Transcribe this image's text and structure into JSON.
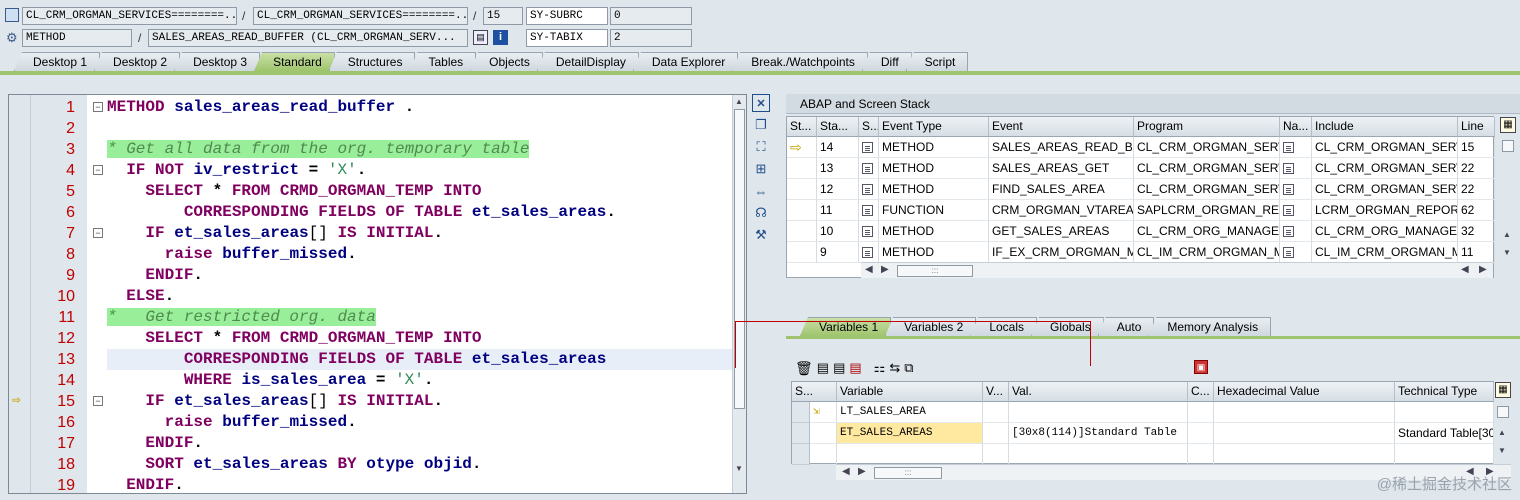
{
  "header": {
    "row1": {
      "class_field_1": "CL_CRM_ORGMAN_SERVICES========...",
      "class_field_2": "CL_CRM_ORGMAN_SERVICES========...",
      "line_field": "15",
      "sysvar_name": "SY-SUBRC",
      "sysvar_value": "0"
    },
    "row2": {
      "kind_field": "METHOD",
      "event_field": "SALES_AREAS_READ_BUFFER (CL_CRM_ORGMAN_SERV...",
      "sysvar_name": "SY-TABIX",
      "sysvar_value": "2"
    },
    "separator": "/"
  },
  "desktop_tabs": [
    {
      "label": "Desktop 1",
      "active": false
    },
    {
      "label": "Desktop 2",
      "active": false
    },
    {
      "label": "Desktop 3",
      "active": false
    },
    {
      "label": "Standard",
      "active": true
    },
    {
      "label": "Structures",
      "active": false
    },
    {
      "label": "Tables",
      "active": false
    },
    {
      "label": "Objects",
      "active": false
    },
    {
      "label": "DetailDisplay",
      "active": false
    },
    {
      "label": "Data Explorer",
      "active": false
    },
    {
      "label": "Break./Watchpoints",
      "active": false
    },
    {
      "label": "Diff",
      "active": false
    },
    {
      "label": "Script",
      "active": false
    }
  ],
  "code": [
    {
      "n": "1",
      "fold": "−",
      "html": "<span class=\"kw\">METHOD</span> <span class=\"id\">sales_areas_read_buffer</span> ."
    },
    {
      "n": "2",
      "fold": "",
      "html": ""
    },
    {
      "n": "3",
      "fold": "",
      "html": "<span class=\"cmt\">* Get all data from the org. temporary table</span>"
    },
    {
      "n": "4",
      "fold": "−",
      "html": "  <span class=\"kw\">IF</span> <span class=\"kw\">NOT</span> <span class=\"id\">iv_restrict</span> = <span class=\"str\">'X'</span>."
    },
    {
      "n": "5",
      "fold": "",
      "html": "    <span class=\"kw\">SELECT</span> * <span class=\"kw\">FROM</span> <span class=\"kw\">CRMD_ORGMAN_TEMP</span> <span class=\"kw\">INTO</span>"
    },
    {
      "n": "6",
      "fold": "",
      "html": "        <span class=\"kw\">CORRESPONDING</span> <span class=\"kw\">FIELDS</span> <span class=\"kw\">OF</span> <span class=\"kw\">TABLE</span> <span class=\"id\">et_sales_areas</span>."
    },
    {
      "n": "7",
      "fold": "−",
      "html": "    <span class=\"kw\">IF</span> <span class=\"id\">et_sales_areas</span><span style=\"font-weight:normal\">[]</span> <span class=\"kw\">IS</span> <span class=\"kw\">INITIAL</span>."
    },
    {
      "n": "8",
      "fold": "",
      "html": "      <span class=\"kw\">raise</span> <span class=\"id\">buffer_missed</span>."
    },
    {
      "n": "9",
      "fold": "",
      "html": "    <span class=\"kw\">ENDIF</span>."
    },
    {
      "n": "10",
      "fold": "",
      "html": "  <span class=\"kw\">ELSE</span>."
    },
    {
      "n": "11",
      "fold": "",
      "html": "<span class=\"cmt\">*   Get restricted org. data</span>"
    },
    {
      "n": "12",
      "fold": "",
      "html": "    <span class=\"kw\">SELECT</span> * <span class=\"kw\">FROM</span> <span class=\"kw\">CRMD_ORGMAN_TEMP</span> <span class=\"kw\">INTO</span>"
    },
    {
      "n": "13",
      "fold": "",
      "html": "        <span class=\"kw\">CORRESPONDING</span> <span class=\"kw\">FIELDS</span> <span class=\"kw\">OF</span> <span class=\"kw\">TABLE</span> <span class=\"id\">et_sales_areas</span>",
      "hl": true
    },
    {
      "n": "14",
      "fold": "",
      "html": "        <span class=\"kw\">WHERE</span> <span class=\"id\">is_sales_area</span> = <span class=\"str\">'X'</span>."
    },
    {
      "n": "15",
      "fold": "−",
      "html": "    <span class=\"kw\">IF</span> <span class=\"id\">et_sales_areas</span><span style=\"font-weight:normal\">[]</span> <span class=\"kw\">IS</span> <span class=\"kw\">INITIAL</span>.",
      "current": true
    },
    {
      "n": "16",
      "fold": "",
      "html": "      <span class=\"kw\">raise</span> <span class=\"id\">buffer_missed</span>."
    },
    {
      "n": "17",
      "fold": "",
      "html": "    <span class=\"kw\">ENDIF</span>."
    },
    {
      "n": "18",
      "fold": "",
      "html": "    <span class=\"kw\">SORT</span> <span class=\"id\">et_sales_areas</span> <span class=\"kw\">BY</span> <span class=\"id\">otype</span> <span class=\"id\">objid</span>."
    },
    {
      "n": "19",
      "fold": "",
      "html": "  <span class=\"kw\">ENDIF</span>."
    }
  ],
  "stack": {
    "title": "ABAP and Screen Stack",
    "columns": [
      "St...",
      "Sta...",
      "S...",
      "Event Type",
      "Event",
      "Program",
      "Na...",
      "Include",
      "Line"
    ],
    "rows": [
      {
        "current": true,
        "level": "14",
        "type": "METHOD",
        "event": "SALES_AREAS_READ_BU...",
        "program": "CL_CRM_ORGMAN_SERV...",
        "include": "CL_CRM_ORGMAN_SERV...",
        "line": "15"
      },
      {
        "current": false,
        "level": "13",
        "type": "METHOD",
        "event": "SALES_AREAS_GET",
        "program": "CL_CRM_ORGMAN_SERV...",
        "include": "CL_CRM_ORGMAN_SERV...",
        "line": "22"
      },
      {
        "current": false,
        "level": "12",
        "type": "METHOD",
        "event": "FIND_SALES_AREA",
        "program": "CL_CRM_ORGMAN_SERV...",
        "include": "CL_CRM_ORGMAN_SERV...",
        "line": "22"
      },
      {
        "current": false,
        "level": "11",
        "type": "FUNCTION",
        "event": "CRM_ORGMAN_VTAREA...",
        "program": "SAPLCRM_ORGMAN_REP...",
        "include": "LCRM_ORGMAN_REPORT...",
        "line": "62"
      },
      {
        "current": false,
        "level": "10",
        "type": "METHOD",
        "event": "GET_SALES_AREAS",
        "program": "CL_CRM_ORG_MANAGEM...",
        "include": "CL_CRM_ORG_MANAGEM...",
        "line": "32"
      },
      {
        "current": false,
        "level": "9",
        "type": "METHOD",
        "event": "IF_EX_CRM_ORGMAN_M...",
        "program": "CL_IM_CRM_ORGMAN_M...",
        "include": "CL_IM_CRM_ORGMAN_M...",
        "line": "11"
      }
    ]
  },
  "var_tabs": [
    {
      "label": "Variables 1",
      "active": true
    },
    {
      "label": "Variables 2",
      "active": false
    },
    {
      "label": "Locals",
      "active": false
    },
    {
      "label": "Globals",
      "active": false
    },
    {
      "label": "Auto",
      "active": false
    },
    {
      "label": "Memory Analysis",
      "active": false
    }
  ],
  "variables": {
    "columns": [
      "S...",
      "Variable",
      "V...",
      "Val.",
      "C...",
      "Hexadecimal Value",
      "Technical Type"
    ],
    "rows": [
      {
        "name": "LT_SALES_AREA",
        "value": "",
        "type": "",
        "selected": false
      },
      {
        "name": "ET_SALES_AREAS",
        "value": "[30x8(114)]Standard Table",
        "type": "Standard Table[30",
        "selected": true
      },
      {
        "name": "",
        "value": "",
        "type": "",
        "selected": false
      }
    ]
  },
  "watermark": "@稀土掘金技术社区",
  "colors": {
    "active_tab": "#9fc46d",
    "line_number": "#c00000",
    "keyword": "#800060",
    "string": "#2e8b57",
    "comment_bg": "#99ee99",
    "selected_cell": "#ffe8a0"
  }
}
